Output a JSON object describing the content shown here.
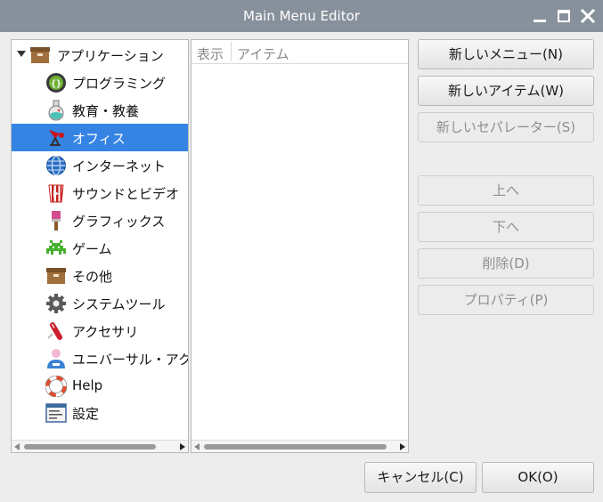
{
  "window": {
    "title": "Main Menu Editor"
  },
  "tree": {
    "root_label": "アプリケーション",
    "items": [
      {
        "label": "プログラミング",
        "icon": "programming-icon"
      },
      {
        "label": "教育・教養",
        "icon": "education-icon"
      },
      {
        "label": "オフィス",
        "icon": "office-icon",
        "selected": true
      },
      {
        "label": "インターネット",
        "icon": "internet-icon"
      },
      {
        "label": "サウンドとビデオ",
        "icon": "sound-video-icon"
      },
      {
        "label": "グラフィックス",
        "icon": "graphics-icon"
      },
      {
        "label": "ゲーム",
        "icon": "games-icon"
      },
      {
        "label": "その他",
        "icon": "other-icon"
      },
      {
        "label": "システムツール",
        "icon": "system-tools-icon"
      },
      {
        "label": "アクセサリ",
        "icon": "accessories-icon"
      },
      {
        "label": "ユニバーサル・アクセス",
        "icon": "universal-access-icon"
      },
      {
        "label": "Help",
        "icon": "help-icon"
      },
      {
        "label": "設定",
        "icon": "preferences-icon"
      }
    ]
  },
  "list": {
    "columns": [
      "表示",
      "アイテム"
    ]
  },
  "buttons": {
    "new_menu": "新しいメニュー(N)",
    "new_item": "新しいアイテム(W)",
    "new_separator": "新しいセパレーター(S)",
    "move_up": "上へ",
    "move_down": "下へ",
    "delete": "削除(D)",
    "properties": "プロパティ(P)",
    "cancel": "キャンセル(C)",
    "ok": "OK(O)"
  },
  "colors": {
    "titlebar": "#87919b",
    "selection": "#3584e4"
  }
}
